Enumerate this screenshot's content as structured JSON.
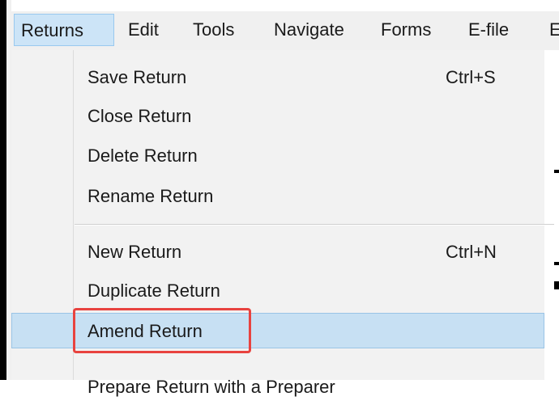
{
  "menubar": {
    "items": [
      {
        "label": "Returns"
      },
      {
        "label": "Edit"
      },
      {
        "label": "Tools"
      },
      {
        "label": "Navigate"
      },
      {
        "label": "Forms"
      },
      {
        "label": "E-file"
      },
      {
        "label": "E"
      }
    ],
    "active_item": "Returns"
  },
  "returns_menu": {
    "group1": [
      {
        "label": "Save Return",
        "shortcut": "Ctrl+S"
      },
      {
        "label": "Close Return",
        "shortcut": ""
      },
      {
        "label": "Delete Return",
        "shortcut": ""
      },
      {
        "label": "Rename Return",
        "shortcut": ""
      }
    ],
    "group2": [
      {
        "label": "New Return",
        "shortcut": "Ctrl+N"
      },
      {
        "label": "Duplicate Return",
        "shortcut": ""
      },
      {
        "label": "Amend Return",
        "shortcut": "",
        "state": "highlighted"
      },
      {
        "label": "Prepare Return with a Preparer",
        "shortcut": "",
        "state": "partially visible"
      }
    ]
  },
  "colors": {
    "menu_background": "#f2f2f2",
    "hover_background": "#c7e0f3",
    "active_menubar": "#cce4f7",
    "annotation_box": "#e8433f"
  }
}
